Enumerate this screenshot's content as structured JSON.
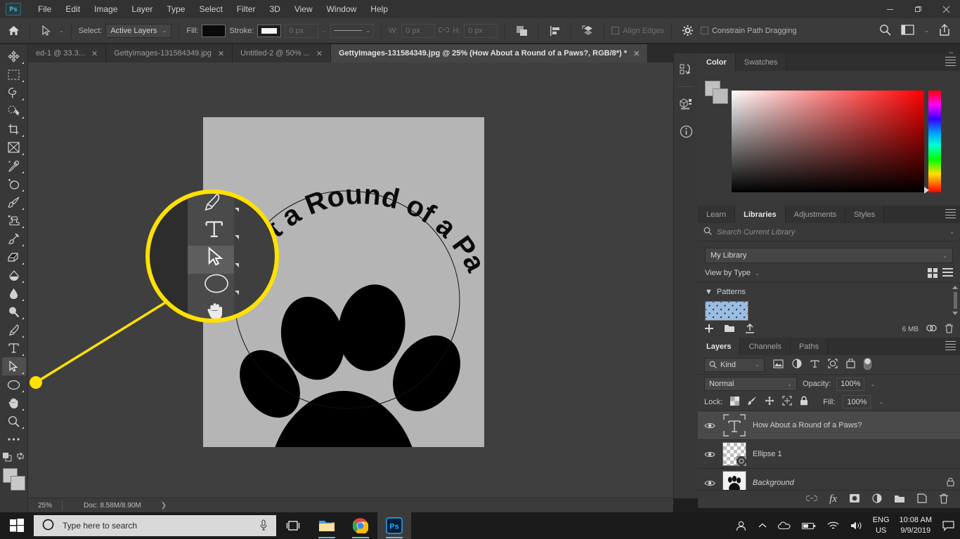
{
  "titlebar": {
    "logo": "Ps",
    "menus": [
      "File",
      "Edit",
      "Image",
      "Layer",
      "Type",
      "Select",
      "Filter",
      "3D",
      "View",
      "Window",
      "Help"
    ],
    "minimize": "—",
    "maximize": "❐",
    "close": "✕"
  },
  "options_bar": {
    "home_icon": "home-icon",
    "tool_icon": "path-selection-icon",
    "select_label": "Select:",
    "select_value": "Active Layers",
    "fill_label": "Fill:",
    "fill_color": "#000000",
    "stroke_label": "Stroke:",
    "stroke_color": "#ffffff",
    "stroke_width": "0 px",
    "w_label": "W:",
    "w_value": "0 px",
    "link_icon": "link-icon",
    "h_label": "H:",
    "h_value": "0 px",
    "path_ops_icon": "path-operations-icon",
    "path_align_icon": "path-alignment-icon",
    "path_arrange_icon": "path-arrangement-icon",
    "align_edges_label": "Align Edges",
    "gear_icon": "gear-icon",
    "constrain_label": "Constrain Path Dragging",
    "search_icon": "search-icon",
    "workspace_icon": "workspace-icon",
    "share_icon": "share-icon"
  },
  "tabs": [
    {
      "label": "ed-1 @ 33.3...",
      "active": false
    },
    {
      "label": "GettyImages-131584349.jpg",
      "active": false
    },
    {
      "label": "Untitled-2 @ 50% ...",
      "active": false
    },
    {
      "label": "GettyImages-131584349.jpg @ 25% (How About a Round of a Paws?, RGB/8*) *",
      "active": true
    }
  ],
  "tabs_overflow": "»",
  "toolbar": {
    "tools": [
      {
        "name": "move-tool",
        "selected": false
      },
      {
        "name": "rectangular-marquee-tool",
        "selected": false
      },
      {
        "name": "lasso-tool",
        "selected": false
      },
      {
        "name": "object-selection-tool",
        "selected": false
      },
      {
        "name": "crop-tool",
        "selected": false
      },
      {
        "name": "frame-tool",
        "selected": false
      },
      {
        "name": "eyedropper-tool",
        "selected": false
      },
      {
        "name": "spot-healing-brush-tool",
        "selected": false
      },
      {
        "name": "brush-tool",
        "selected": false
      },
      {
        "name": "clone-stamp-tool",
        "selected": false
      },
      {
        "name": "history-brush-tool",
        "selected": false
      },
      {
        "name": "eraser-tool",
        "selected": false
      },
      {
        "name": "gradient-tool",
        "selected": false
      },
      {
        "name": "blur-tool",
        "selected": false
      },
      {
        "name": "dodge-tool",
        "selected": false
      },
      {
        "name": "pen-tool",
        "selected": false
      },
      {
        "name": "type-tool",
        "selected": false
      },
      {
        "name": "path-selection-tool",
        "selected": true
      },
      {
        "name": "ellipse-tool",
        "selected": false
      },
      {
        "name": "hand-tool",
        "selected": false
      },
      {
        "name": "zoom-tool",
        "selected": false
      },
      {
        "name": "edit-toolbar-tool",
        "selected": false
      }
    ],
    "foreground_color": "#c8c8c8",
    "background_color": "#c8c8c8"
  },
  "canvas": {
    "artwork_text": "About a Round of a Paws?",
    "background_color": "#b5b5b5",
    "art_color": "#000000",
    "canvas_bg": "#3f3f3f"
  },
  "callout": {
    "highlight_color": "#f5e котор",
    "marker_color": "#ffe100",
    "tools_shown": [
      "pen-tool",
      "type-tool",
      "path-selection-tool",
      "ellipse-tool",
      "hand-tool"
    ]
  },
  "status_bar": {
    "zoom": "25%",
    "doc_info": "Doc: 8.58M/8.90M",
    "expand": "❯"
  },
  "rail": {
    "items": [
      "actions-icon",
      "3d-icon",
      "info-icon"
    ]
  },
  "color_panel": {
    "tabs": [
      {
        "label": "Color",
        "active": true
      },
      {
        "label": "Swatches",
        "active": false
      }
    ],
    "menu_icon": "panel-menu-icon"
  },
  "libraries_panel": {
    "tabs": [
      {
        "label": "Learn",
        "active": false
      },
      {
        "label": "Libraries",
        "active": true
      },
      {
        "label": "Adjustments",
        "active": false
      },
      {
        "label": "Styles",
        "active": false
      }
    ],
    "search_placeholder": "Search Current Library",
    "search_icon": "search-icon",
    "library_name": "My Library",
    "view_by": "View by Type",
    "grid_icon": "grid-view-icon",
    "list_icon": "list-view-icon",
    "section_title": "Patterns",
    "size_label": "6 MB",
    "add_icon": "add-icon",
    "folder_icon": "folder-icon",
    "upload_icon": "upload-icon",
    "sync_icon": "sync-icon",
    "delete_icon": "delete-icon"
  },
  "layers_panel": {
    "tabs": [
      {
        "label": "Layers",
        "active": true
      },
      {
        "label": "Channels",
        "active": false
      },
      {
        "label": "Paths",
        "active": false
      }
    ],
    "filter_label": "Kind",
    "filter_icons": [
      "pixel-filter-icon",
      "adjustment-filter-icon",
      "type-filter-icon",
      "shape-filter-icon",
      "smart-object-filter-icon"
    ],
    "filter_toggle": "filter-toggle-icon",
    "blend_mode": "Normal",
    "opacity_label": "Opacity:",
    "opacity_value": "100%",
    "lock_label": "Lock:",
    "lock_icons": [
      "lock-transparency-icon",
      "lock-image-icon",
      "lock-position-icon",
      "lock-artboard-icon",
      "lock-all-icon"
    ],
    "fill_label": "Fill:",
    "fill_value": "100%",
    "layers": [
      {
        "name": "How About a Round of a Paws?",
        "type": "type",
        "visible": true,
        "selected": true,
        "locked": false,
        "italic": false
      },
      {
        "name": "Ellipse 1",
        "type": "shape",
        "visible": true,
        "selected": false,
        "locked": false,
        "italic": false
      },
      {
        "name": "Background",
        "type": "image",
        "visible": true,
        "selected": false,
        "locked": true,
        "italic": true
      }
    ],
    "footer_icons": [
      "link-layers-icon",
      "layer-style-icon",
      "layer-mask-icon",
      "adjustment-layer-icon",
      "new-group-icon",
      "new-layer-icon",
      "delete-layer-icon"
    ],
    "fx_label": "fx"
  },
  "taskbar": {
    "start_icon": "windows-start-icon",
    "search_placeholder": "Type here to search",
    "cortana_icon": "cortana-circle-icon",
    "mic_icon": "microphone-icon",
    "taskview_icon": "task-view-icon",
    "apps": [
      {
        "name": "file-explorer-icon",
        "running": true
      },
      {
        "name": "chrome-icon",
        "running": true
      },
      {
        "name": "photoshop-icon",
        "running": true,
        "active": true
      }
    ],
    "tray": [
      "people-icon",
      "chevron-up-icon",
      "onedrive-icon",
      "battery-icon",
      "wifi-icon",
      "volume-icon"
    ],
    "language": "ENG",
    "region": "US",
    "time": "10:08 AM",
    "date": "9/9/2019",
    "notification_icon": "notification-icon"
  }
}
